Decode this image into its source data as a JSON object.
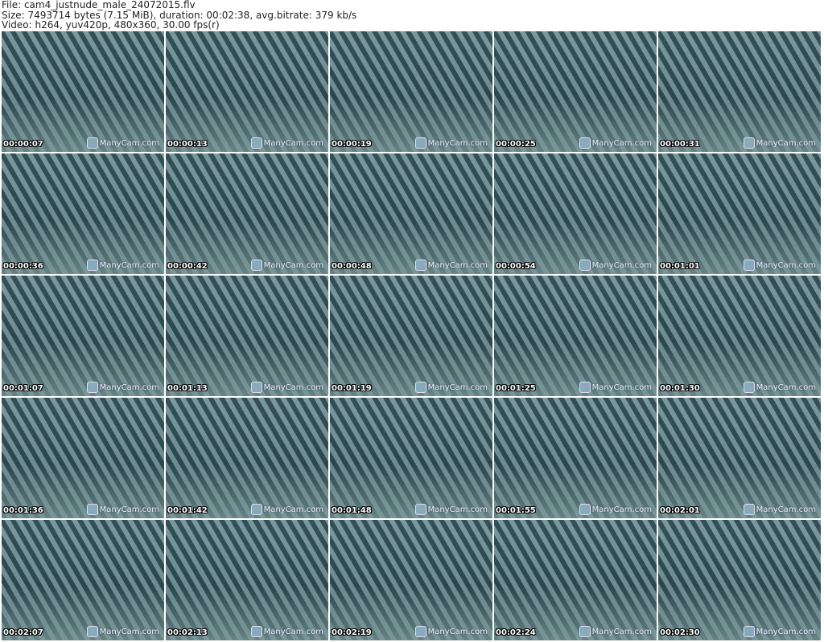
{
  "header": {
    "line1": "File: cam4_justnude_male_24072015.flv",
    "line2": "Size: 7493714 bytes (7.15 MiB), duration: 00:02:38, avg.bitrate: 379 kb/s",
    "line3": "Video: h264, yuv420p, 480x360, 30.00 fps(r)"
  },
  "watermark": "ManyCam.com",
  "timestamps": [
    "00:00:07",
    "00:00:13",
    "00:00:19",
    "00:00:25",
    "00:00:31",
    "00:00:36",
    "00:00:42",
    "00:00:48",
    "00:00:54",
    "00:01:01",
    "00:01:07",
    "00:01:13",
    "00:01:19",
    "00:01:25",
    "00:01:30",
    "00:01:36",
    "00:01:42",
    "00:01:48",
    "00:01:55",
    "00:02:01",
    "00:02:07",
    "00:02:13",
    "00:02:19",
    "00:02:24",
    "00:02:30"
  ]
}
